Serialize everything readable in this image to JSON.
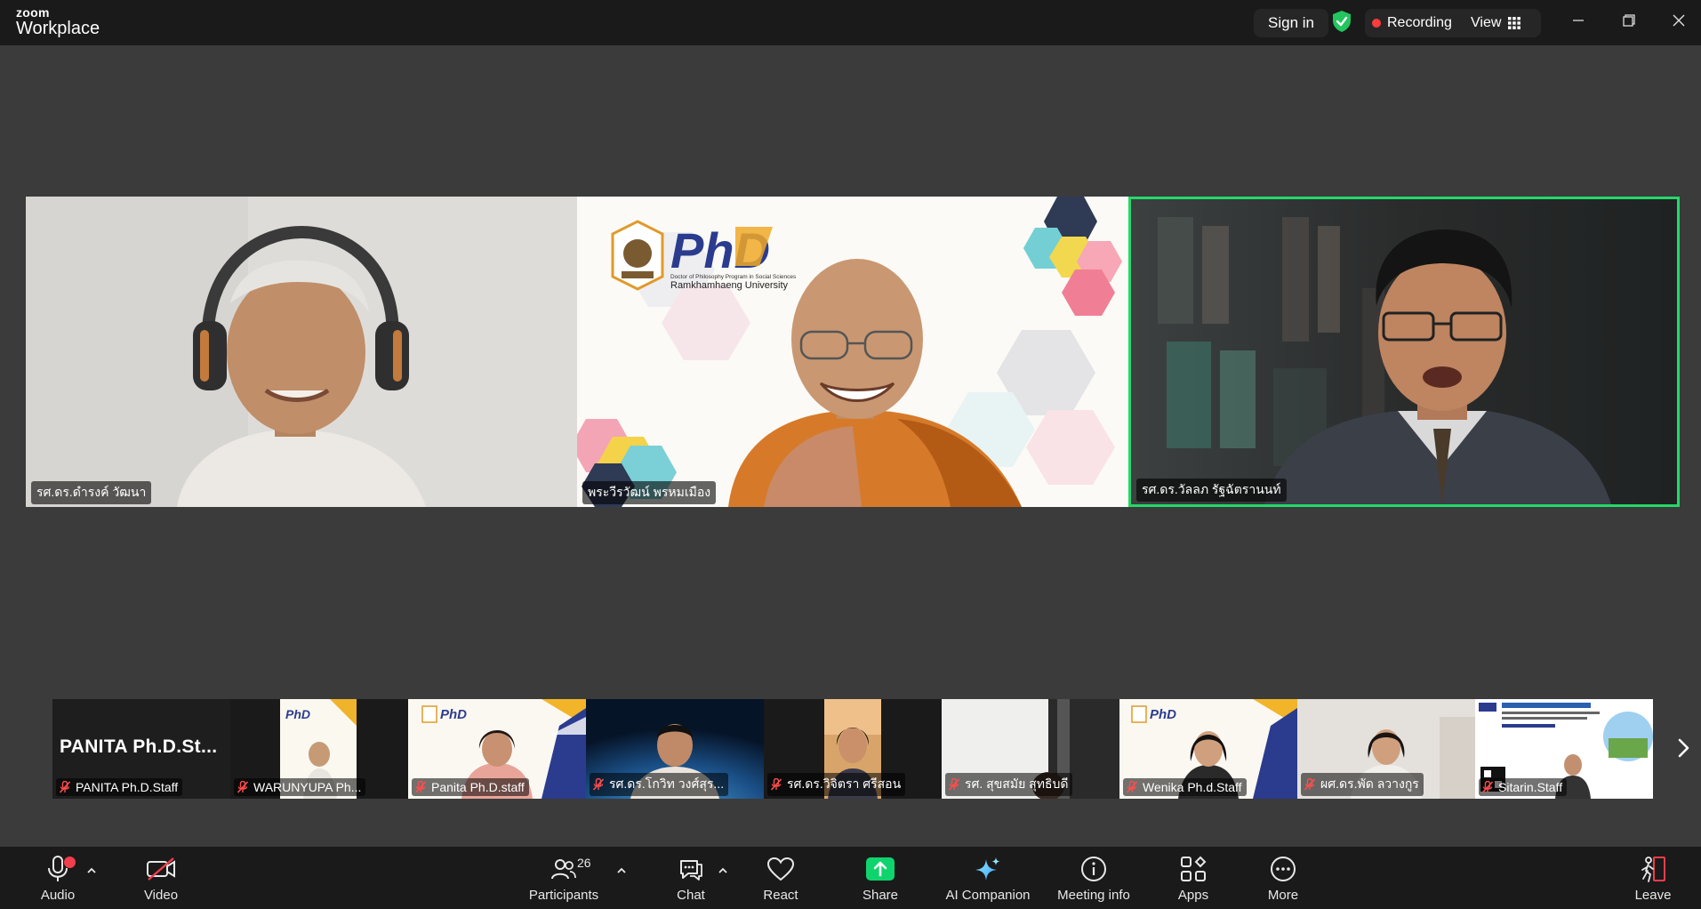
{
  "app": {
    "logo_top": "zoom",
    "logo_bottom": "Workplace",
    "sign_in": "Sign in",
    "recording_label": "Recording",
    "view_label": "View"
  },
  "colors": {
    "active_speaker": "#23d96a",
    "recording_dot": "#ff3b3b",
    "share_green": "#0fd46d",
    "leave_red": "#f23d4c"
  },
  "main_tiles": [
    {
      "name": "รศ.ดร.ดำรงค์ วัฒนา"
    },
    {
      "name": "พระวีรวัฒน์ พรหมเมือง",
      "logo_text": "PhD",
      "logo_sub1": "Doctor of Philosophy Program in Social Sciences",
      "logo_sub2": "Ramkhamhaeng University"
    },
    {
      "name": "รศ.ดร.วัลลภ รัฐฉัตรานนท์",
      "active": true
    }
  ],
  "filmstrip": [
    {
      "name": "PANITA Ph.D.Staff",
      "display": "PANITA  Ph.D.St...",
      "muted": true
    },
    {
      "name": "WARUNYUPA Ph...",
      "muted": true
    },
    {
      "name": "Panita Ph.D.staff",
      "muted": true
    },
    {
      "name": "รศ.ดร.โกวิท วงศ์สุร...",
      "muted": true
    },
    {
      "name": "รศ.ดร.วิจิตรา ศรีสอน",
      "muted": true
    },
    {
      "name": "รศ. สุขสมัย สุทธิบดี",
      "muted": true
    },
    {
      "name": "Wenika Ph.d.Staff",
      "muted": true
    },
    {
      "name": "ผศ.ดร.พัด ลวางกูร",
      "muted": true
    },
    {
      "name": "Sitarin.Staff",
      "muted": true
    }
  ],
  "toolbar": {
    "audio": "Audio",
    "video": "Video",
    "participants": "Participants",
    "participants_count": "26",
    "chat": "Chat",
    "react": "React",
    "share": "Share",
    "ai_companion": "AI Companion",
    "meeting_info": "Meeting info",
    "apps": "Apps",
    "more": "More",
    "leave": "Leave"
  }
}
